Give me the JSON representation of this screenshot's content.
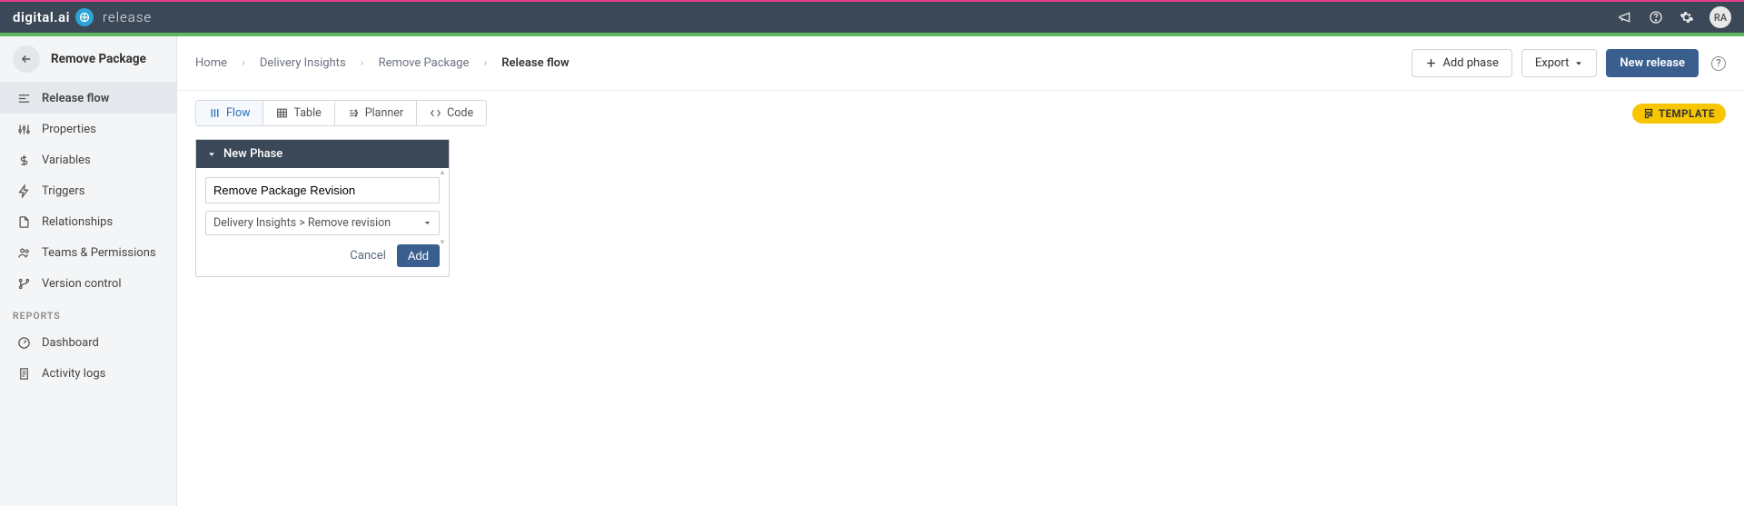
{
  "brand": {
    "company": "digital.ai",
    "product": "release"
  },
  "avatar": "RA",
  "sidebar": {
    "title": "Remove Package",
    "items": [
      {
        "label": "Release flow",
        "icon": "flow"
      },
      {
        "label": "Properties",
        "icon": "sliders"
      },
      {
        "label": "Variables",
        "icon": "dollar"
      },
      {
        "label": "Triggers",
        "icon": "bolt"
      },
      {
        "label": "Relationships",
        "icon": "doc"
      },
      {
        "label": "Teams & Permissions",
        "icon": "team"
      },
      {
        "label": "Version control",
        "icon": "branch"
      }
    ],
    "section": "REPORTS",
    "reports": [
      {
        "label": "Dashboard",
        "icon": "gauge"
      },
      {
        "label": "Activity logs",
        "icon": "log"
      }
    ]
  },
  "breadcrumbs": [
    "Home",
    "Delivery Insights",
    "Remove Package",
    "Release flow"
  ],
  "actions": {
    "add_phase": "Add phase",
    "export": "Export",
    "new_release": "New release"
  },
  "viewtabs": [
    "Flow",
    "Table",
    "Planner",
    "Code"
  ],
  "template_badge": "TEMPLATE",
  "phase": {
    "header": "New Phase",
    "task_name": "Remove Package Revision",
    "task_type": "Delivery Insights > Remove revision",
    "cancel": "Cancel",
    "add": "Add"
  }
}
